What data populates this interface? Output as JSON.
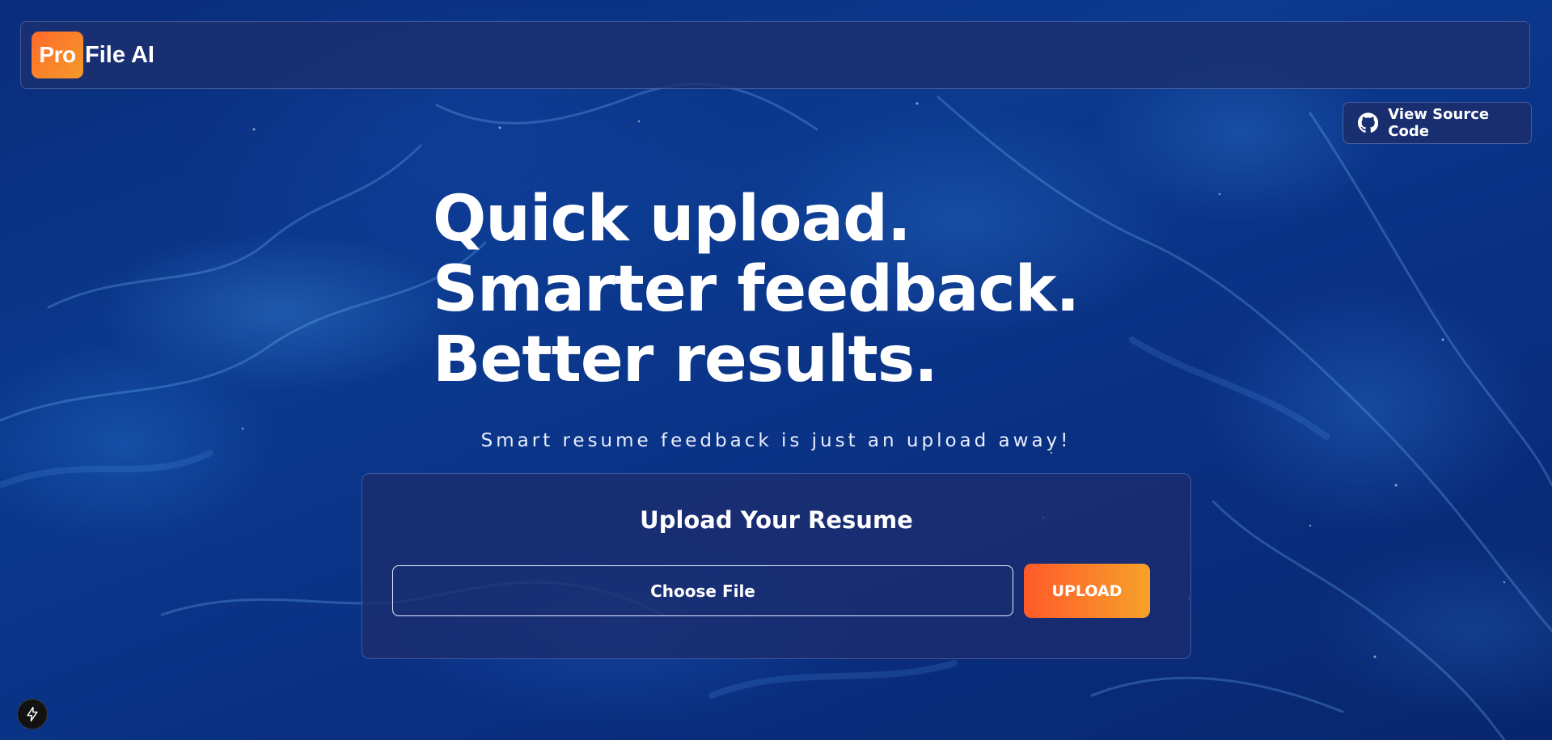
{
  "navbar": {
    "logo_badge": "Pro",
    "logo_text": "File AI"
  },
  "source_button": {
    "label": "View Source Code",
    "icon": "github-icon"
  },
  "hero": {
    "line1": "Quick upload.",
    "line2": "Smarter feedback.",
    "line3": "Better results."
  },
  "tagline": "Smart resume feedback is just an upload away!",
  "upload_card": {
    "title": "Upload Your Resume",
    "file_input_label": "Choose File",
    "upload_button_label": "UPLOAD"
  },
  "dev_tools": {
    "icon": "lightning-bolt-icon"
  },
  "colors": {
    "background": "#0b3a8f",
    "accent_start": "#ff5a2a",
    "accent_end": "#f6a22a",
    "panel": "#1c2d6e"
  }
}
